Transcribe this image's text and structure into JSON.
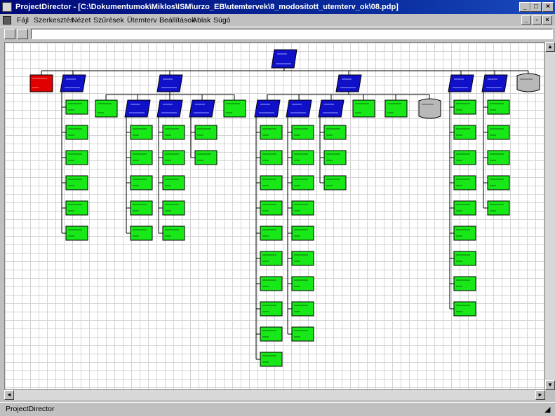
{
  "window": {
    "title": "ProjectDirector - [C:\\Dokumentumok\\Miklos\\ISM\\urzo_EB\\utemtervek\\8_modositott_utemterv_ok\\08.pdp]",
    "minimize": "_",
    "maximize": "□",
    "close": "×"
  },
  "menu": {
    "items": [
      "Fájl",
      "Szerkesztés",
      "Nézet",
      "Szűrések",
      "Ütemterv",
      "Beállítások",
      "Ablak",
      "Súgó"
    ]
  },
  "statusbar": {
    "text": "ProjectDirector"
  },
  "colors": {
    "root": "#1010c8",
    "branch": "#1010c8",
    "leaf": "#18e818",
    "red": "#e00000",
    "gray": "#b8b8b8"
  },
  "org": {
    "root": "Projekt",
    "branches": [
      {
        "kind": "red",
        "leaves": []
      },
      {
        "kind": "blue",
        "leaves": [
          "",
          "",
          "",
          "",
          "",
          ""
        ]
      },
      {
        "kind": "blue",
        "children": [
          {
            "kind": "green",
            "leaves": []
          },
          {
            "kind": "blue",
            "leaves": [
              "",
              "",
              "",
              "",
              ""
            ]
          },
          {
            "kind": "blue",
            "leaves": [
              "",
              "",
              "",
              "",
              ""
            ]
          },
          {
            "kind": "blue",
            "leaves": [
              "",
              ""
            ]
          },
          {
            "kind": "green",
            "leaves": []
          }
        ]
      },
      {
        "kind": "blue",
        "children": [
          {
            "kind": "blue",
            "leaves": [
              "",
              "",
              "",
              "",
              "",
              "",
              "",
              "",
              "",
              ""
            ]
          },
          {
            "kind": "blue",
            "leaves": [
              "",
              "",
              "",
              "",
              "",
              "",
              "",
              "",
              ""
            ]
          },
          {
            "kind": "blue",
            "leaves": [
              "",
              "",
              ""
            ]
          },
          {
            "kind": "green",
            "leaves": []
          },
          {
            "kind": "green",
            "leaves": []
          },
          {
            "kind": "gray",
            "leaves": []
          }
        ]
      },
      {
        "kind": "blue",
        "leaves": [
          "",
          "",
          "",
          "",
          "",
          "",
          "",
          "",
          ""
        ]
      },
      {
        "kind": "blue",
        "leaves": [
          "",
          "",
          "",
          "",
          ""
        ]
      },
      {
        "kind": "gray",
        "leaves": []
      }
    ]
  }
}
